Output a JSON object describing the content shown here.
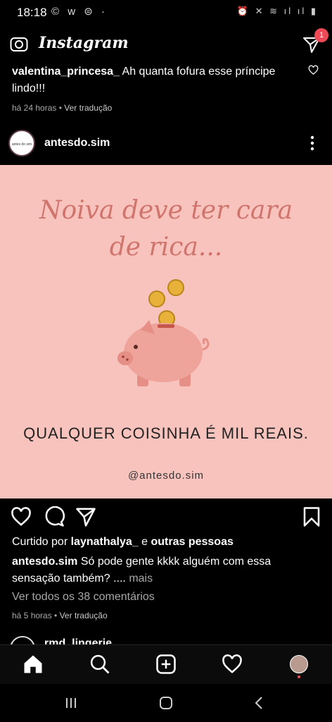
{
  "status_bar": {
    "time": "18:18",
    "left_icons": "© w ⊜ ·",
    "right_icons": "⏰ ✕ ≋ ıl ıl ▮"
  },
  "app": {
    "title": "Instagram",
    "dm_badge": "1"
  },
  "top_comment": {
    "user": "valentina_princesa_",
    "text": "Ah quanta fofura esse príncipe lindo!!!",
    "time": "há 24 horas",
    "translate": "Ver tradução"
  },
  "post": {
    "username": "antesdo.sim",
    "avatar_text": "antes do sim",
    "image": {
      "headline_line1": "Noiva deve ter cara",
      "headline_line2": "de rica...",
      "subline": "QUALQUER COISINHA É MIL REAIS.",
      "handle": "@antesdo.sim"
    },
    "liked_by_prefix": "Curtido por",
    "liked_by_user": "laynathalya_",
    "liked_by_mid": "e",
    "liked_by_others": "outras pessoas",
    "caption_user": "antesdo.sim",
    "caption_text": "Só pode gente kkkk alguém com essa sensação também? ....",
    "caption_more": "mais",
    "view_all_comments": "Ver todos os 38 comentários",
    "time": "há 5 horas",
    "translate": "Ver tradução"
  },
  "next_post": {
    "username": "rmd_lingerie"
  },
  "colors": {
    "background": "#000000",
    "post_bg": "#f8c3bd",
    "script_text": "#d0756e",
    "badge": "#ed4956"
  }
}
